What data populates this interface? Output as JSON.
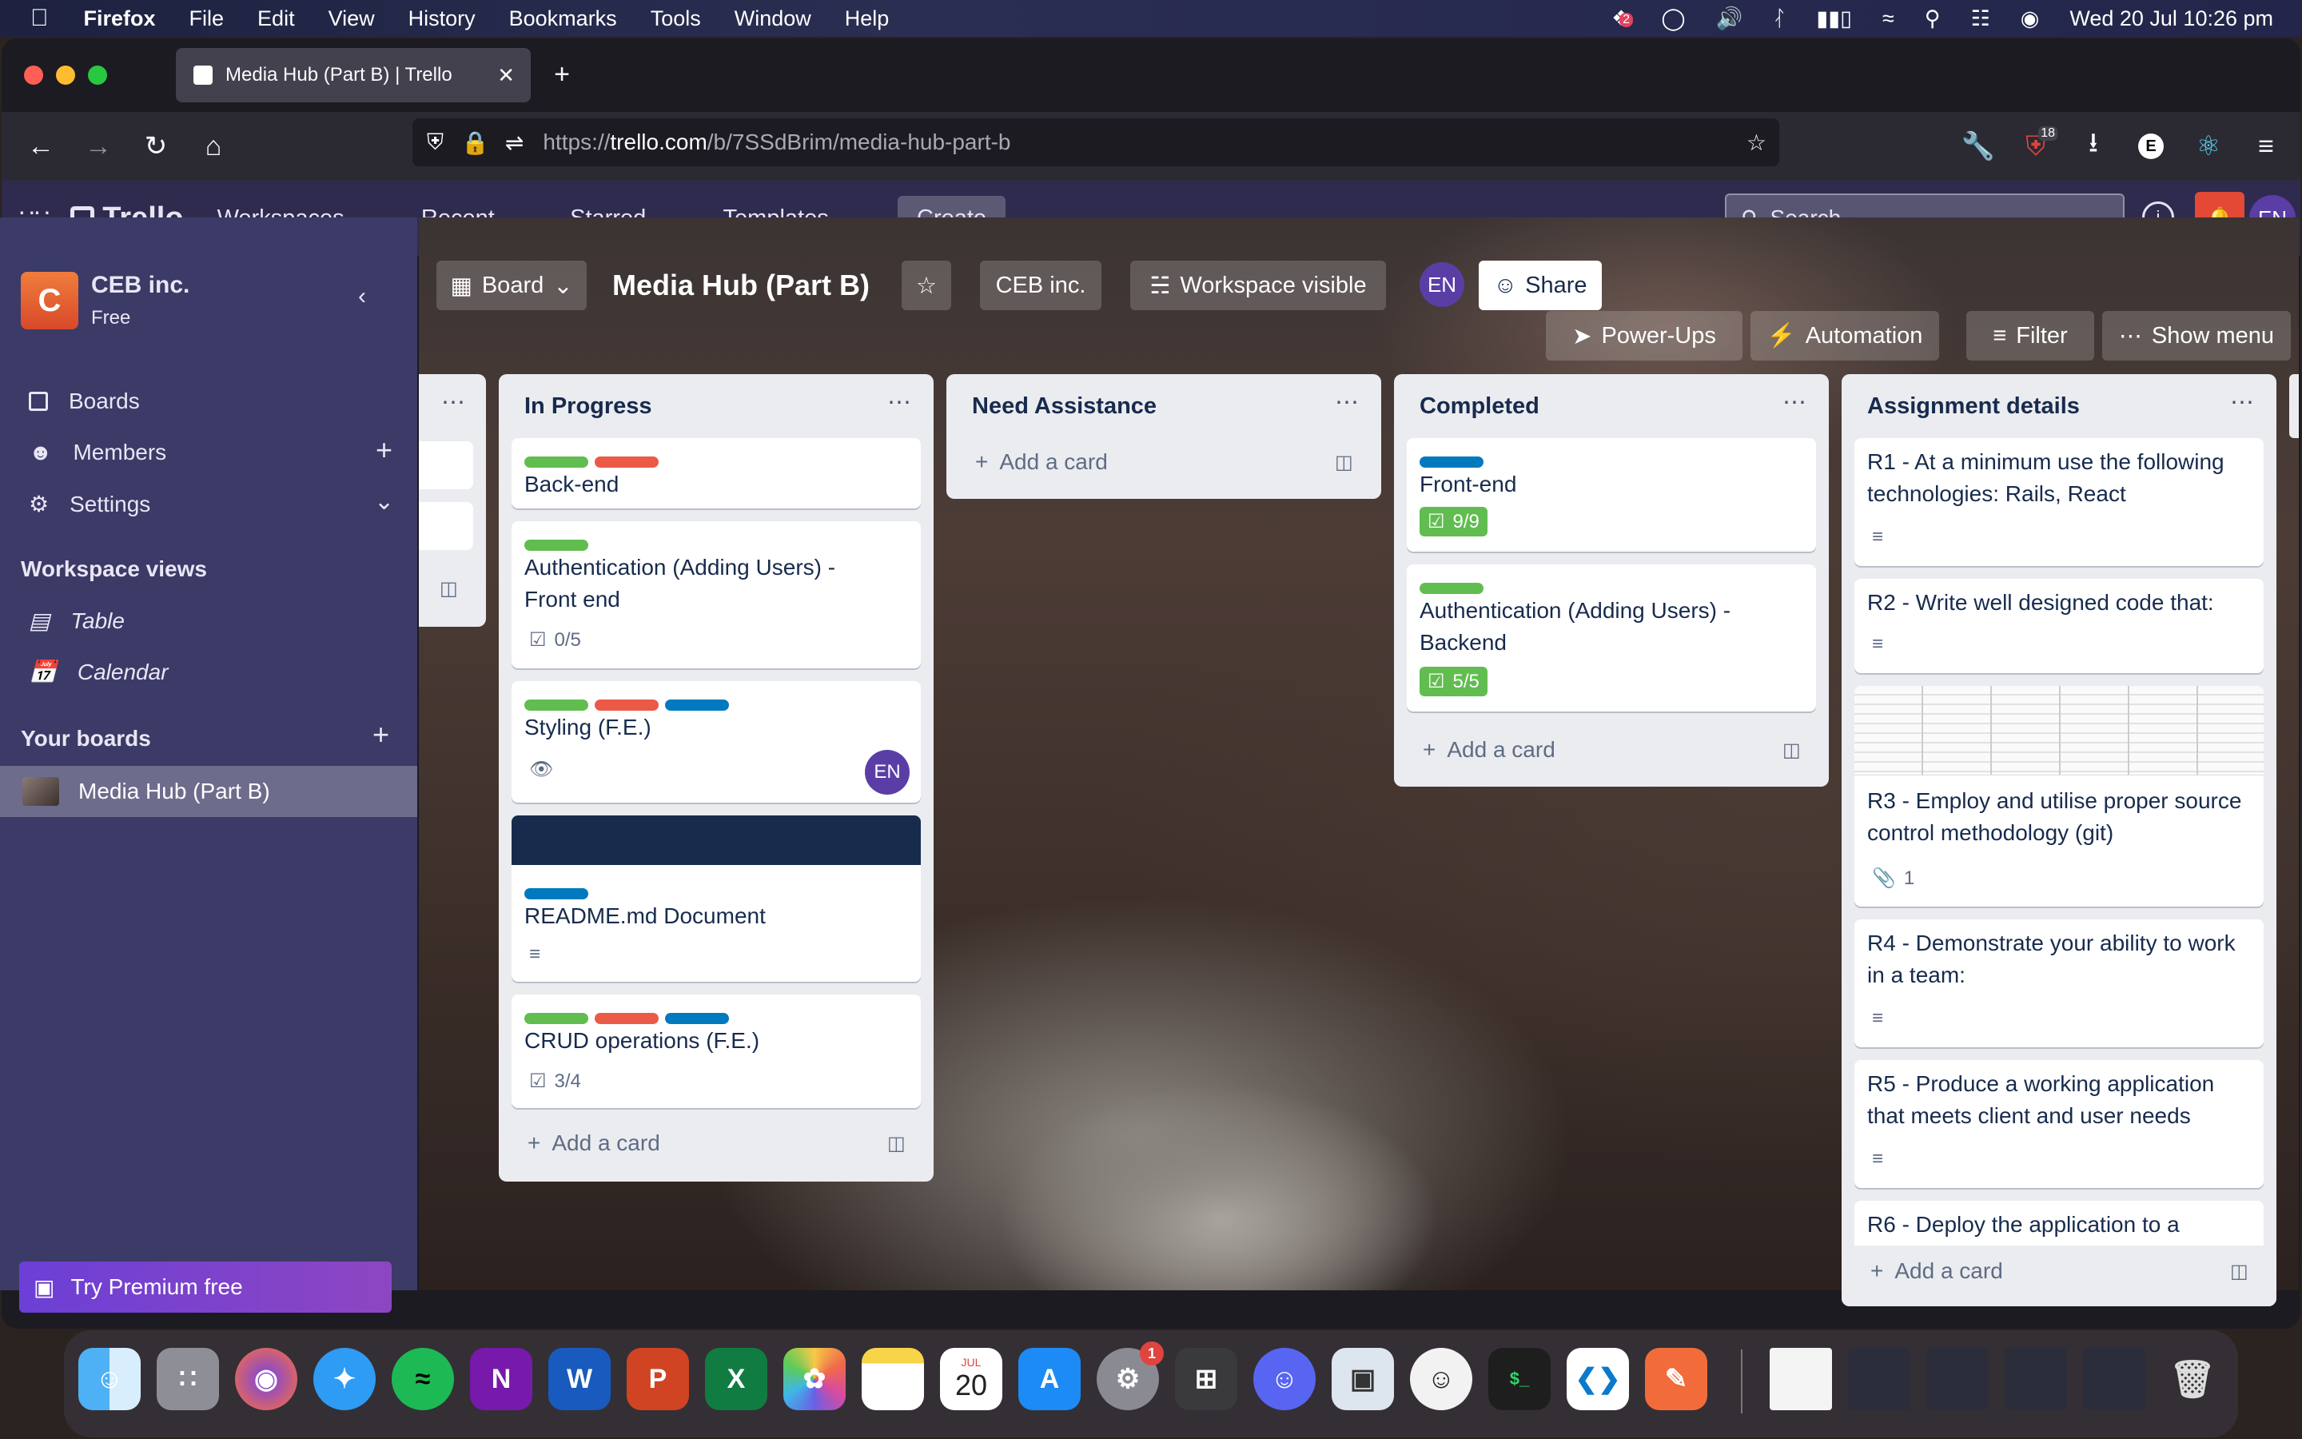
{
  "menubar": {
    "app": "Firefox",
    "items": [
      "File",
      "Edit",
      "View",
      "History",
      "Bookmarks",
      "Tools",
      "Window",
      "Help"
    ],
    "datetime": "Wed 20 Jul  10:26 pm",
    "dropbox_badge": "2"
  },
  "browser": {
    "tab_title": "Media Hub (Part B) | Trello",
    "url_prefix": "https://",
    "url_domain": "trello.com",
    "url_path": "/b/7SSdBrim/media-hub-part-b",
    "ext_badge": "18",
    "ext_letter": "E"
  },
  "trello": {
    "logo": "Trello",
    "nav": [
      "Workspaces",
      "Recent",
      "Starred",
      "Templates"
    ],
    "create": "Create",
    "search_placeholder": "Search",
    "avatar": "EN"
  },
  "sidebar": {
    "workspace_initial": "C",
    "workspace_name": "CEB inc.",
    "plan": "Free",
    "items": [
      "Boards",
      "Members",
      "Settings"
    ],
    "views_heading": "Workspace views",
    "views": [
      "Table",
      "Calendar"
    ],
    "boards_heading": "Your boards",
    "boards": [
      "Media Hub (Part B)"
    ],
    "premium": "Try Premium free"
  },
  "boardbar": {
    "view": "Board",
    "title": "Media Hub (Part B)",
    "workspace": "CEB inc.",
    "visibility": "Workspace visible",
    "avatar": "EN",
    "share": "Share",
    "powerups": "Power-Ups",
    "automation": "Automation",
    "filter": "Filter",
    "show_menu": "Show menu"
  },
  "lists": {
    "in_progress": {
      "title": "In Progress",
      "cards": [
        {
          "title": "Back-end"
        },
        {
          "title": "Authentication (Adding Users) - Front end",
          "badge": "0/5"
        },
        {
          "title": "Styling (F.E.)",
          "avatar": "EN"
        },
        {
          "title": "README.md Document"
        },
        {
          "title": "CRUD operations (F.E.)",
          "badge": "3/4"
        }
      ],
      "add": "Add a card"
    },
    "need_assistance": {
      "title": "Need Assistance",
      "add": "Add a card"
    },
    "completed": {
      "title": "Completed",
      "cards": [
        {
          "title": "Front-end",
          "badge": "9/9"
        },
        {
          "title": "Authentication (Adding Users) - Backend",
          "badge": "5/5"
        }
      ],
      "add": "Add a card"
    },
    "assignment": {
      "title": "Assignment details",
      "cards": [
        {
          "title": "R1 - At a minimum use the following technologies: Rails, React"
        },
        {
          "title": "R2 - Write well designed code that:"
        },
        {
          "title": "R3 - Employ and utilise proper source control methodology (git)",
          "attachments": "1"
        },
        {
          "title": "R4 - Demonstrate your ability to work in a team:"
        },
        {
          "title": "R5 - Produce a working application that meets client and user needs"
        },
        {
          "title": "R6 - Deploy the application to a"
        }
      ],
      "add": "Add a card"
    }
  },
  "dock": {
    "calendar_month": "JUL",
    "calendar_day": "20",
    "settings_badge": "1"
  }
}
